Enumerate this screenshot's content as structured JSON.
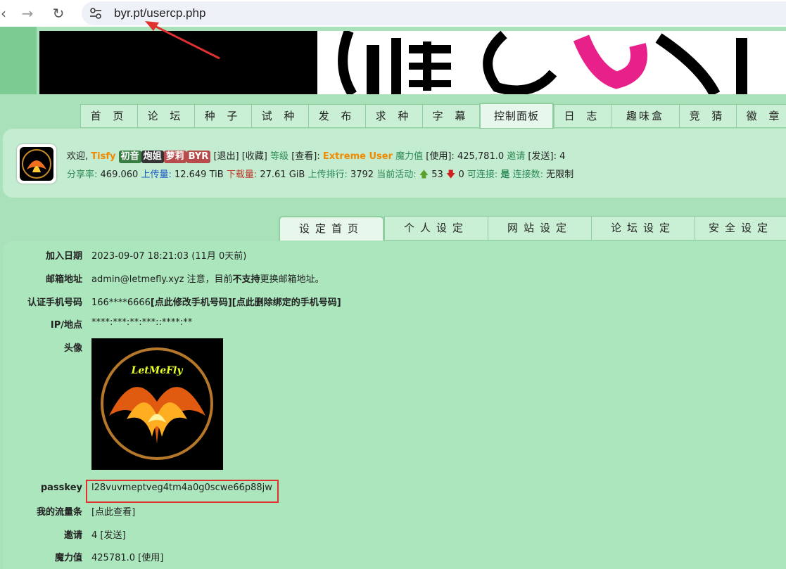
{
  "browser": {
    "url": "byr.pt/usercp.php"
  },
  "nav_tabs": [
    "首 页",
    "论 坛",
    "种 子",
    "试 种",
    "发 布",
    "求 种",
    "字 幕",
    "控制面板",
    "日 志",
    "趣味盒",
    "竞 猜",
    "徽 章"
  ],
  "user": {
    "welcome": "欢迎,",
    "name": "Tisfy",
    "badges": [
      {
        "text": "初音",
        "color": "#3a7d44"
      },
      {
        "text": "炮姐",
        "color": "#333333"
      },
      {
        "text": "萝莉",
        "color": "#b84b4b"
      },
      {
        "text": "BYR",
        "color": "#b84b4b"
      }
    ],
    "logout": "[退出]",
    "favorites": "[收藏]",
    "level_label": "等级",
    "view": "[查看]:",
    "level": "Extreme User",
    "magic_label": "魔力值",
    "use": "[使用]:",
    "magic_value": "425,781.0",
    "invite_label": "邀请",
    "send": "[发送]:",
    "invite_count": "4",
    "ratio_label": "分享率:",
    "ratio": "469.060",
    "upload_label": "上传量:",
    "upload": "12.649 TiB",
    "download_label": "下载量:",
    "download": "27.61 GiB",
    "rank_label": "上传排行:",
    "rank": "3792",
    "active_label": "当前活动:",
    "seeding": "53",
    "leeching": "0",
    "connectable_label": "可连接:",
    "connectable": "是",
    "connections_label": "连接数:",
    "connections": "无限制"
  },
  "sub_tabs": [
    "设定首页",
    "个人设定",
    "网站设定",
    "论坛设定",
    "安全设定"
  ],
  "fields": {
    "join_date_label": "加入日期",
    "join_date": "2023-09-07 18:21:03 (11月 0天前)",
    "email_label": "邮箱地址",
    "email": "admin@letmefly.xyz 注意，目前",
    "email_bold": "不支持",
    "email_tail": "更换邮箱地址。",
    "phone_label": "认证手机号码",
    "phone": "166****6666",
    "phone_links": "[点此修改手机号码][点此删除绑定的手机号码]",
    "ip_label": "IP/地点",
    "ip": "****:***:**:***::****:**",
    "avatar_label": "头像",
    "avatar_text": "LetMeFly",
    "passkey_label": "passkey",
    "passkey": "l28vuvmeptveg4tm4a0g0scwe66p88jw",
    "traffic_label": "我的流量条",
    "traffic": "[点此查看]",
    "invite_label": "邀请",
    "invite": "4 [发送]",
    "magic_label": "魔力值",
    "magic": "425781.0 [使用]"
  },
  "colors": {
    "annotation": "#e03030",
    "accent_green": "#2e8b57",
    "level_orange": "#f08a00"
  }
}
